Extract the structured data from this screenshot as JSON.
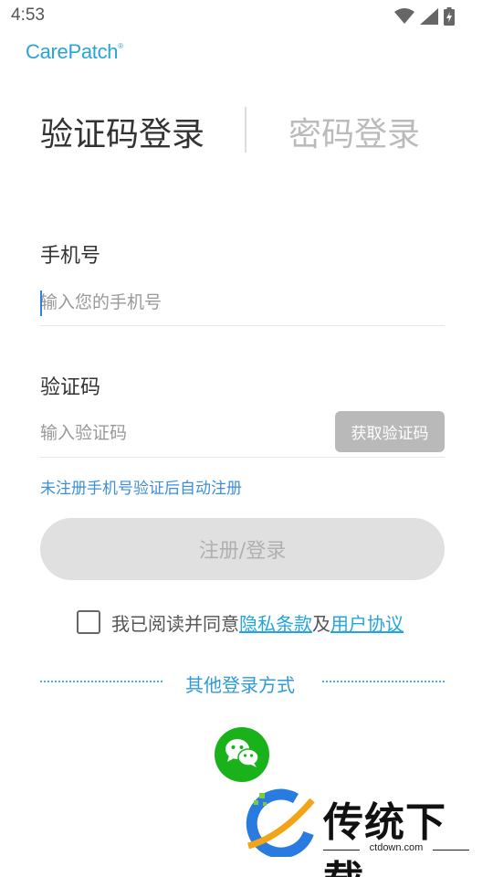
{
  "status_bar": {
    "time": "4:53",
    "icons": [
      "wifi-icon",
      "signal-icon",
      "battery-icon"
    ]
  },
  "logo": {
    "text": "CarePatch",
    "mark": "®"
  },
  "tabs": {
    "active": "验证码登录",
    "inactive": "密码登录"
  },
  "phone": {
    "label": "手机号",
    "placeholder": "输入您的手机号"
  },
  "code": {
    "label": "验证码",
    "placeholder": "输入验证码",
    "button": "获取验证码"
  },
  "hint": "未注册手机号验证后自动注册",
  "submit": "注册/登录",
  "agreement": {
    "prefix": "我已阅读并同意",
    "privacy": "隐私条款",
    "and": "及",
    "terms": "用户协议",
    "checked": false
  },
  "other_login": {
    "label": "其他登录方式",
    "options": [
      "wechat-icon"
    ]
  },
  "watermark": {
    "brand": "传统下载",
    "url": "ctdown.com"
  },
  "colors": {
    "accent": "#2aa3d8",
    "link": "#24a5e0",
    "wechat": "#19b21a",
    "disabled_button": "#e0e0e0"
  }
}
